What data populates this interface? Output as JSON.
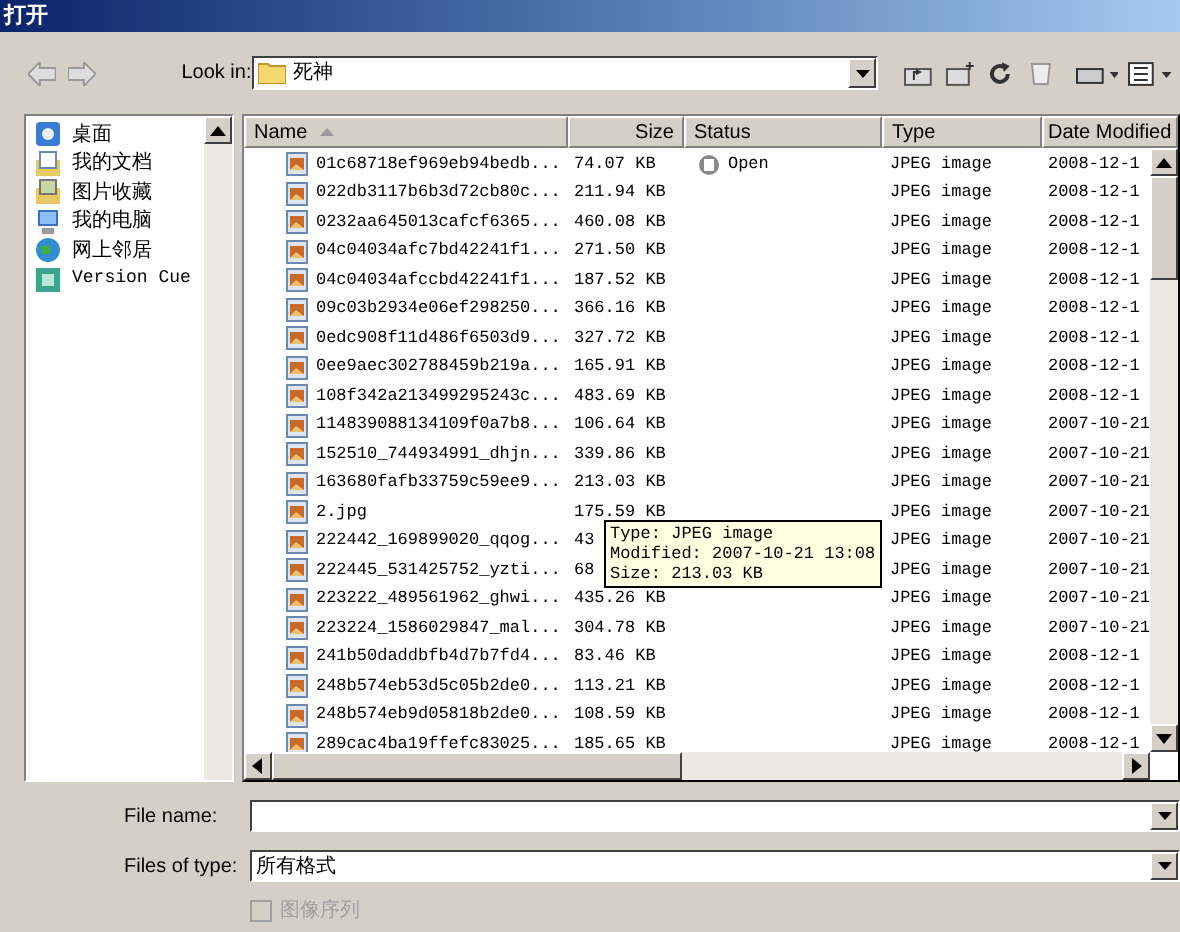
{
  "window": {
    "title": "打开"
  },
  "toolbar": {
    "look_in_label": "Look in:",
    "look_in_value": "死神"
  },
  "places": [
    {
      "label": "桌面",
      "kind": "desktop"
    },
    {
      "label": "我的文档",
      "kind": "documents"
    },
    {
      "label": "图片收藏",
      "kind": "pictures"
    },
    {
      "label": "我的电脑",
      "kind": "computer"
    },
    {
      "label": "网上邻居",
      "kind": "network"
    },
    {
      "label": "Version Cue",
      "kind": "cue"
    }
  ],
  "file_list": {
    "columns": [
      {
        "label": "Name",
        "sorted": true
      },
      {
        "label": "Size",
        "sorted": false
      },
      {
        "label": "Status",
        "sorted": false
      },
      {
        "label": "Type",
        "sorted": false
      },
      {
        "label": "Date Modified",
        "sorted": false
      }
    ],
    "rows": [
      {
        "name": "01c68718ef969eb94bedb...",
        "size": "74.07 KB",
        "status": "Open",
        "type": "JPEG image",
        "date": "2008-12-1"
      },
      {
        "name": "022db3117b6b3d72cb80c...",
        "size": "211.94 KB",
        "type": "JPEG image",
        "date": "2008-12-1"
      },
      {
        "name": "0232aa645013cafcf6365...",
        "size": "460.08 KB",
        "type": "JPEG image",
        "date": "2008-12-1"
      },
      {
        "name": "04c04034afc7bd42241f1...",
        "size": "271.50 KB",
        "type": "JPEG image",
        "date": "2008-12-1"
      },
      {
        "name": "04c04034afccbd42241f1...",
        "size": "187.52 KB",
        "type": "JPEG image",
        "date": "2008-12-1"
      },
      {
        "name": "09c03b2934e06ef298250...",
        "size": "366.16 KB",
        "type": "JPEG image",
        "date": "2008-12-1"
      },
      {
        "name": "0edc908f11d486f6503d9...",
        "size": "327.72 KB",
        "type": "JPEG image",
        "date": "2008-12-1"
      },
      {
        "name": "0ee9aec302788459b219a...",
        "size": "165.91 KB",
        "type": "JPEG image",
        "date": "2008-12-1"
      },
      {
        "name": "108f342a213499295243c...",
        "size": "483.69 KB",
        "type": "JPEG image",
        "date": "2008-12-1"
      },
      {
        "name": "114839088134109f0a7b8...",
        "size": "106.64 KB",
        "type": "JPEG image",
        "date": "2007-10-21"
      },
      {
        "name": "152510_744934991_dhjn...",
        "size": "339.86 KB",
        "type": "JPEG image",
        "date": "2007-10-21"
      },
      {
        "name": "163680fafb33759c59ee9...",
        "size": "213.03 KB",
        "type": "JPEG image",
        "date": "2007-10-21"
      },
      {
        "name": "2.jpg",
        "size": "175.59 KB",
        "type": "JPEG image",
        "date": "2007-10-21"
      },
      {
        "name": "222442_169899020_qqog...",
        "size": "43",
        "type": "JPEG image",
        "date": "2007-10-21"
      },
      {
        "name": "222445_531425752_yzti...",
        "size": "68",
        "type": "JPEG image",
        "date": "2007-10-21"
      },
      {
        "name": "223222_489561962_ghwi...",
        "size": "435.26 KB",
        "type": "JPEG image",
        "date": "2007-10-21"
      },
      {
        "name": "223224_1586029847_mal...",
        "size": "304.78 KB",
        "type": "JPEG image",
        "date": "2007-10-21"
      },
      {
        "name": "241b50daddbfb4d7b7fd4...",
        "size": "83.46 KB",
        "type": "JPEG image",
        "date": "2008-12-1"
      },
      {
        "name": "248b574eb53d5c05b2de0...",
        "size": "113.21 KB",
        "type": "JPEG image",
        "date": "2008-12-1"
      },
      {
        "name": "248b574eb9d05818b2de0...",
        "size": "108.59 KB",
        "type": "JPEG image",
        "date": "2008-12-1"
      },
      {
        "name": "289cac4ba19ffefc83025...",
        "size": "185.65 KB",
        "type": "JPEG image",
        "date": "2008-12-1"
      }
    ],
    "tooltip": {
      "lines": [
        "Type: JPEG image",
        "Modified: 2007-10-21 13:08",
        "Size: 213.03 KB"
      ]
    }
  },
  "file_name": {
    "label": "File name:"
  },
  "files_of_type": {
    "label": "Files of type:",
    "value": "所有格式"
  },
  "image_sequence": {
    "label": "图像序列",
    "checked": false,
    "disabled": true
  }
}
